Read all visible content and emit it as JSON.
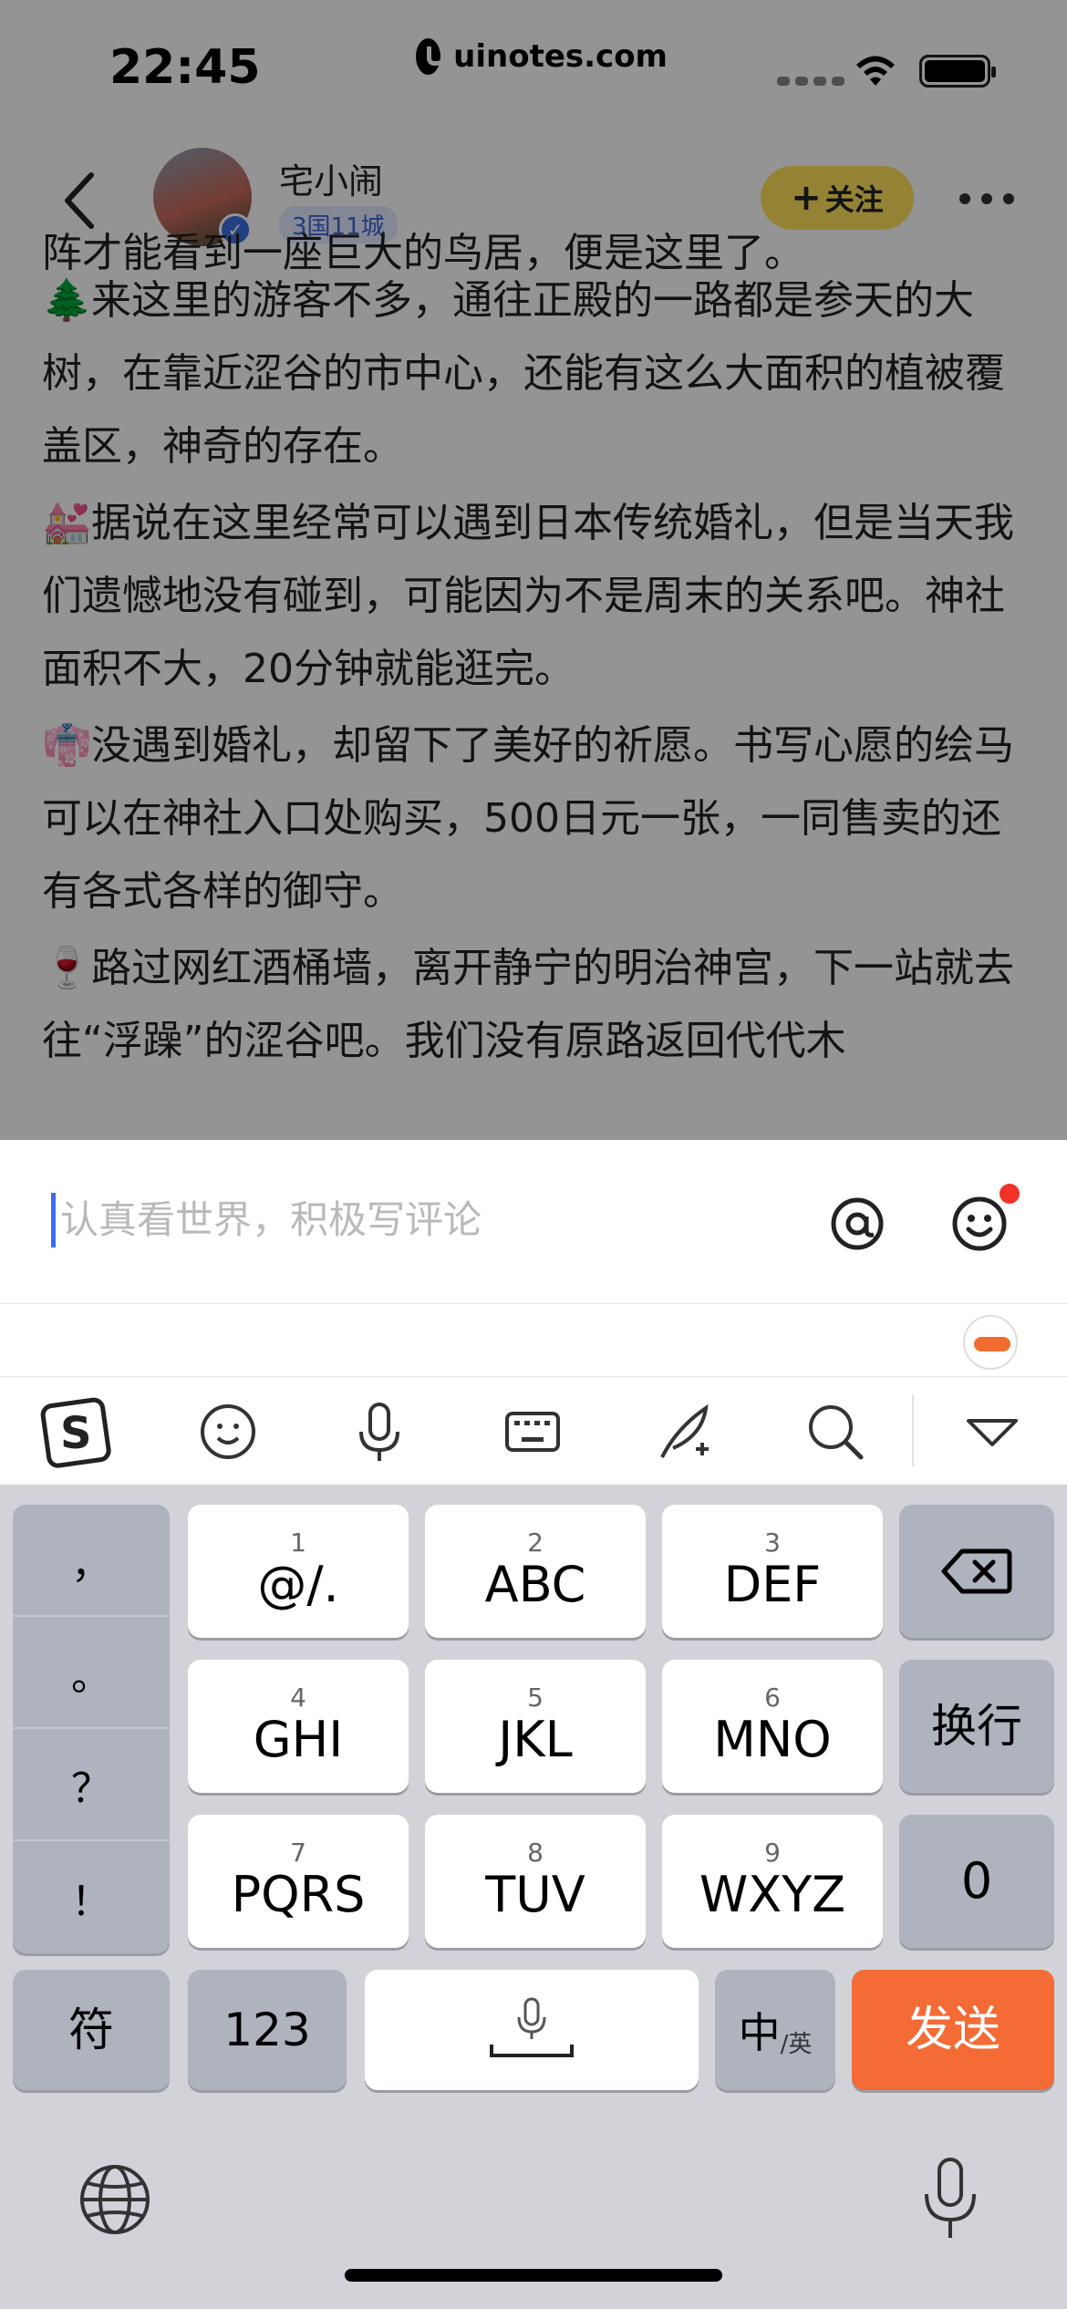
{
  "status": {
    "time": "22:45",
    "site": "uinotes.com"
  },
  "header": {
    "username": "宅小闹",
    "tag": "3国11城",
    "follow_label": "关注"
  },
  "article": {
    "cut_line": "阵才能看到一座巨大的鸟居，便是这里了。",
    "paragraphs": [
      {
        "emoji": "🌲",
        "text": "来这里的游客不多，通往正殿的一路都是参天的大树，在靠近涩谷的市中心，还能有这么大面积的植被覆盖区，神奇的存在。"
      },
      {
        "emoji": "💒",
        "text": "据说在这里经常可以遇到日本传统婚礼，但是当天我们遗憾地没有碰到，可能因为不是周末的关系吧。神社面积不大，20分钟就能逛完。"
      },
      {
        "emoji": "👘",
        "text": "没遇到婚礼，却留下了美好的祈愿。书写心愿的绘马可以在神社入口处购买，500日元一张，一同售卖的还有各式各样的御守。"
      },
      {
        "emoji": "🍷",
        "text": "路过网红酒桶墙，离开静宁的明治神宫，下一站就去往“浮躁”的涩谷吧。我们没有原路返回代代木"
      }
    ]
  },
  "comment": {
    "placeholder": "认真看世界，积极写评论"
  },
  "keyboard": {
    "punct": [
      "，",
      "。",
      "？",
      "！"
    ],
    "keys": [
      {
        "num": "1",
        "label": "@/."
      },
      {
        "num": "2",
        "label": "ABC"
      },
      {
        "num": "3",
        "label": "DEF"
      },
      {
        "num": "4",
        "label": "GHI"
      },
      {
        "num": "5",
        "label": "JKL"
      },
      {
        "num": "6",
        "label": "MNO"
      },
      {
        "num": "7",
        "label": "PQRS"
      },
      {
        "num": "8",
        "label": "TUV"
      },
      {
        "num": "9",
        "label": "WXYZ"
      }
    ],
    "newline": "换行",
    "zero": "0",
    "symbols": "符",
    "numbers": "123",
    "lang_main": "中",
    "lang_sub": "/英",
    "send": "发送"
  },
  "colors": {
    "accent": "#f46b36",
    "follow": "#ffe25a",
    "caret": "#3a6cf0",
    "verified": "#3c6fe0"
  }
}
